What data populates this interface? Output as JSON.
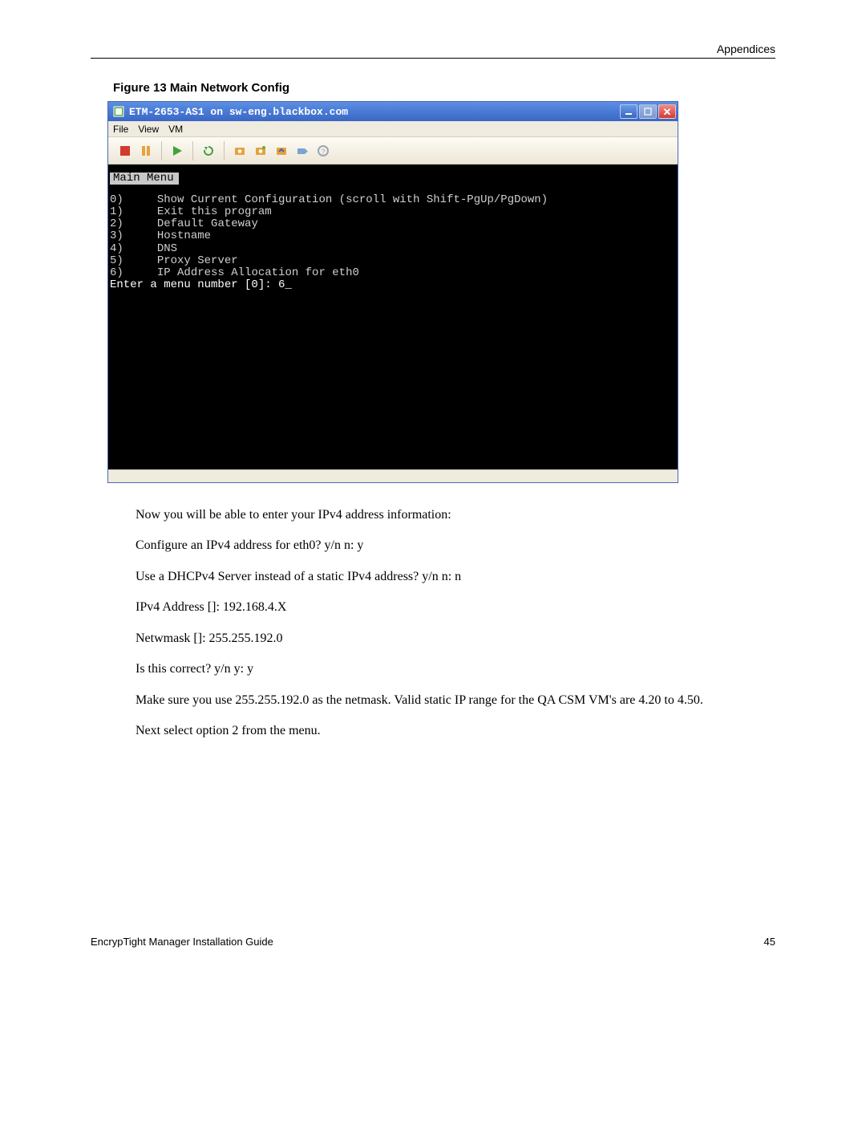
{
  "header": {
    "section": "Appendices"
  },
  "figure": {
    "caption": "Figure 13    Main Network Config"
  },
  "window": {
    "title": "ETM-2653-AS1 on sw-eng.blackbox.com",
    "menubar": {
      "items": [
        "File",
        "View",
        "VM"
      ]
    },
    "console": {
      "menu_title": "Main Menu",
      "items": [
        {
          "num": "0)",
          "label": "Show Current Configuration (scroll with Shift-PgUp/PgDown)"
        },
        {
          "num": "1)",
          "label": "Exit this program"
        },
        {
          "num": "2)",
          "label": "Default Gateway"
        },
        {
          "num": "3)",
          "label": "Hostname"
        },
        {
          "num": "4)",
          "label": "DNS"
        },
        {
          "num": "5)",
          "label": "Proxy Server"
        },
        {
          "num": "6)",
          "label": "IP Address Allocation for eth0"
        }
      ],
      "prompt": "Enter a menu number [0]: 6_"
    }
  },
  "body": {
    "p1": "Now you will be able to enter your IPv4 address information:",
    "p2": "Configure an IPv4 address for eth0? y/n n: y",
    "p3": "Use a DHCPv4 Server instead of a static IPv4 address? y/n n: n",
    "p4": "IPv4 Address []: 192.168.4.X",
    "p5": "Netwmask []: 255.255.192.0",
    "p6": "Is this correct? y/n y: y",
    "p7": "Make sure you use 255.255.192.0 as the netmask. Valid static IP range for the QA CSM VM's are 4.20 to 4.50.",
    "p8": "Next select option 2 from the menu."
  },
  "footer": {
    "left": "EncrypTight Manager Installation Guide",
    "right": "45"
  }
}
